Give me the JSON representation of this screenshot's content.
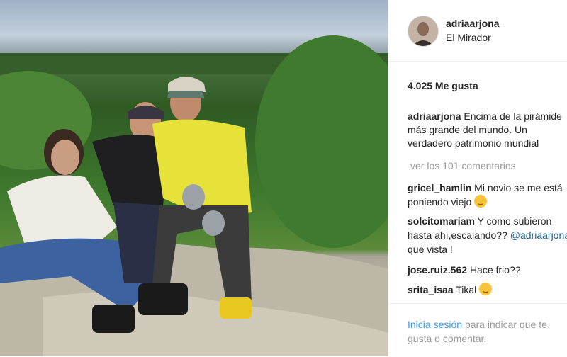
{
  "post": {
    "username": "adriaarjona",
    "location": "El Mirador",
    "likes": "4.025 Me gusta",
    "caption_user": "adriaarjona",
    "caption_text": "Encima de la pirámide más grande del mundo. Un verdadero patrimonio mundial"
  },
  "comments_link": "ver los 101 comentarios",
  "comments": [
    {
      "user": "gricel_hamlin",
      "text": "Mi novio se me está poniendo viejo",
      "emoji": "kiss-emoji"
    },
    {
      "user": "solcitomariam",
      "text": "Y como subieron hasta ahí,escalando??",
      "mention": "@adriaarjona",
      "text2": "que vista !"
    },
    {
      "user": "jose.ruiz.562",
      "text": "Hace frio??"
    },
    {
      "user": "srita_isaa",
      "text": "Tikal",
      "emoji": "smile-emoji"
    }
  ],
  "footer": {
    "login_label": "Inicia sesión",
    "rest": "para indicar que te gusta o comentar."
  }
}
